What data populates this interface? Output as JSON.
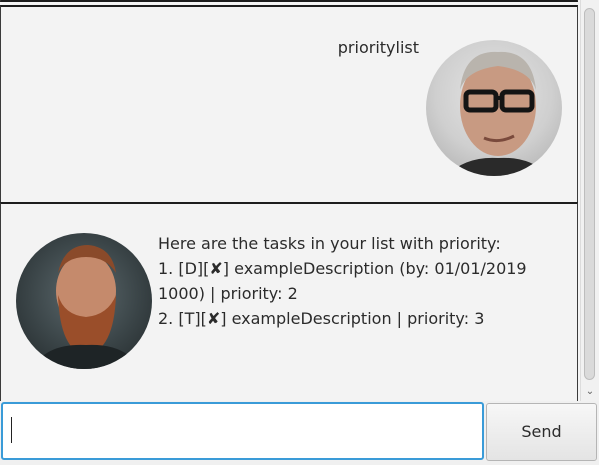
{
  "conversation": {
    "user_message": {
      "text": "prioritylist",
      "avatar": "user-avatar-photo"
    },
    "bot_message": {
      "lines": [
        "Here are the tasks in your list with priority:",
        "1. [D][✘] exampleDescription (by: 01/01/2019",
        "1000) | priority: 2",
        "2. [T][✘] exampleDescription | priority: 3"
      ],
      "avatar": "bot-avatar-photo"
    }
  },
  "input": {
    "value": "",
    "placeholder": ""
  },
  "send_button": {
    "label": "Send"
  },
  "scrollbar": {
    "down_arrow": "⌄"
  }
}
